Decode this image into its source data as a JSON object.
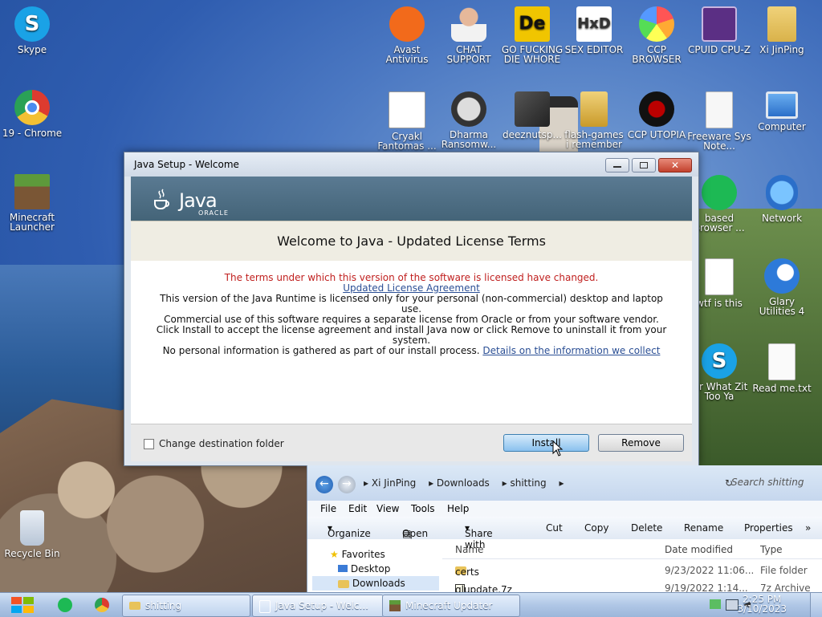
{
  "desktop": {
    "icons": [
      {
        "label": "Skype",
        "icon": "skype-icon"
      },
      {
        "label": "19 - Chrome",
        "icon": "chrome-icon"
      },
      {
        "label": "Minecraft Launcher",
        "icon": "minecraft-icon"
      },
      {
        "label": "Recycle Bin",
        "icon": "recycle-bin-icon"
      },
      {
        "label": "Avast Antivirus",
        "icon": "avast-icon"
      },
      {
        "label": "CHAT SUPPORT",
        "icon": "support-person-icon"
      },
      {
        "label": "GO FUCKING DIE WHORE",
        "icon": "de-icon"
      },
      {
        "label": "SEX EDITOR",
        "icon": "hxd-icon"
      },
      {
        "label": "CCP BROWSER",
        "icon": "ccp-browser-icon"
      },
      {
        "label": "CPUID CPU-Z",
        "icon": "cpuz-icon"
      },
      {
        "label": "Xi JinPing",
        "icon": "user-folder-icon"
      },
      {
        "label": "Cryakl Fantomas ...",
        "icon": "window-app-icon"
      },
      {
        "label": "Dharma Ransomw...",
        "icon": "skull-icon"
      },
      {
        "label": "deeznutsp...",
        "icon": "stack-icon"
      },
      {
        "label": "flash-games i remember",
        "icon": "folder-icon"
      },
      {
        "label": "CCP UTOPIA",
        "icon": "utopia-icon"
      },
      {
        "label": "Freeware Sys Note...",
        "icon": "document-icon"
      },
      {
        "label": "Computer",
        "icon": "computer-icon"
      },
      {
        "label": "based browser ...",
        "icon": "chat-bubble-icon"
      },
      {
        "label": "Network",
        "icon": "network-icon"
      },
      {
        "label": "wtf is this",
        "icon": "calendar-icon"
      },
      {
        "label": "Glary Utilities 4",
        "icon": "glary-icon"
      },
      {
        "label": "Mr What Zit Too Ya",
        "icon": "skype-icon"
      },
      {
        "label": "Read me.txt",
        "icon": "text-file-icon"
      }
    ]
  },
  "dialog": {
    "title": "Java Setup - Welcome",
    "logo_word": "Java",
    "logo_sub": "ORACLE",
    "heading": "Welcome to Java - Updated License Terms",
    "warning": "The terms under which this version of the software is licensed have changed.",
    "link1": "Updated License Agreement",
    "para1": "This version of the Java Runtime is licensed only for your personal (non-commercial) desktop and laptop use.",
    "para2": "Commercial use of this software requires a separate license from Oracle or from your software vendor.",
    "para3": "Click Install to accept the license agreement and install Java now or click Remove to uninstall it from your system.",
    "para4_prefix": "No personal information is gathered as part of our install process.",
    "link2": "Details on the information we collect",
    "checkbox_label": "Change destination folder",
    "install_label": "Install",
    "remove_label": "Remove"
  },
  "explorer": {
    "breadcrumb": [
      "Xi JinPing",
      "Downloads",
      "shitting"
    ],
    "search_placeholder": "Search shitting",
    "menu": [
      "File",
      "Edit",
      "View",
      "Tools",
      "Help"
    ],
    "toolbar": [
      "Organize",
      "Open",
      "Share with",
      "Cut",
      "Copy",
      "Delete",
      "Rename",
      "Properties"
    ],
    "nav": [
      "Favorites",
      "Desktop",
      "Downloads"
    ],
    "columns": [
      "Name",
      "Date modified",
      "Type"
    ],
    "rows": [
      {
        "name": "certs",
        "date": "9/23/2022 11:06...",
        "type": "File folder"
      },
      {
        "name": "glupdate.7z",
        "date": "9/19/2022 1:14...",
        "type": "7z Archive"
      }
    ]
  },
  "taskbar": {
    "items": [
      {
        "label": "shitting"
      },
      {
        "label": "Java Setup - Welc..."
      },
      {
        "label": "Minecraft Updater"
      }
    ],
    "time": "2:25 PM",
    "date": "3/10/2023"
  }
}
